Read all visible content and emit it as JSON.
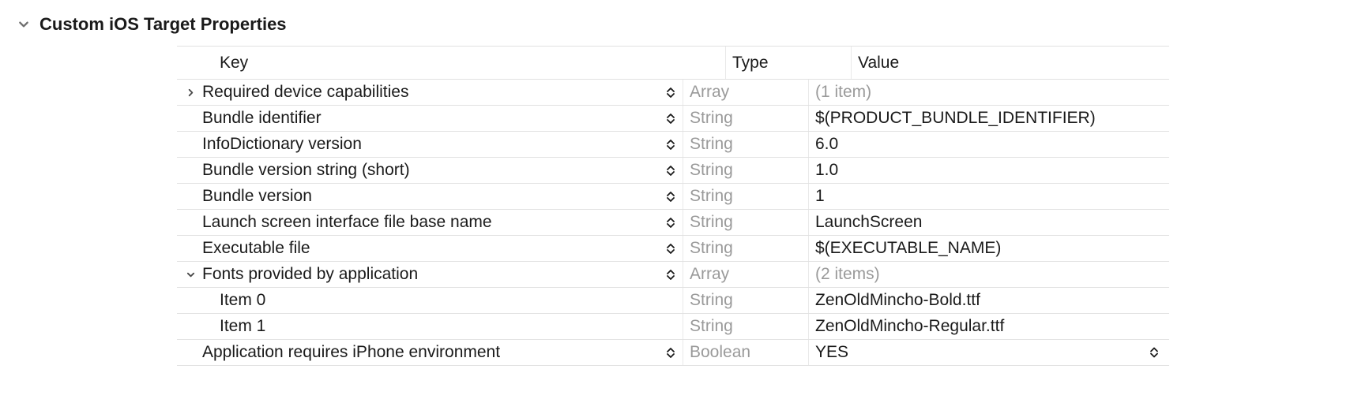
{
  "section_title": "Custom iOS Target Properties",
  "columns": {
    "key": "Key",
    "type": "Type",
    "value": "Value"
  },
  "rows": [
    {
      "key": "Required device capabilities",
      "type": "Array",
      "value": "(1 item)",
      "disclosure": "right",
      "indent": 0,
      "key_stepper": true,
      "value_gray": true,
      "value_stepper": false
    },
    {
      "key": "Bundle identifier",
      "type": "String",
      "value": "$(PRODUCT_BUNDLE_IDENTIFIER)",
      "disclosure": "none",
      "indent": 0,
      "key_stepper": true,
      "value_gray": false,
      "value_stepper": false
    },
    {
      "key": "InfoDictionary version",
      "type": "String",
      "value": "6.0",
      "disclosure": "none",
      "indent": 0,
      "key_stepper": true,
      "value_gray": false,
      "value_stepper": false
    },
    {
      "key": "Bundle version string (short)",
      "type": "String",
      "value": "1.0",
      "disclosure": "none",
      "indent": 0,
      "key_stepper": true,
      "value_gray": false,
      "value_stepper": false
    },
    {
      "key": "Bundle version",
      "type": "String",
      "value": "1",
      "disclosure": "none",
      "indent": 0,
      "key_stepper": true,
      "value_gray": false,
      "value_stepper": false
    },
    {
      "key": "Launch screen interface file base name",
      "type": "String",
      "value": "LaunchScreen",
      "disclosure": "none",
      "indent": 0,
      "key_stepper": true,
      "value_gray": false,
      "value_stepper": false
    },
    {
      "key": "Executable file",
      "type": "String",
      "value": "$(EXECUTABLE_NAME)",
      "disclosure": "none",
      "indent": 0,
      "key_stepper": true,
      "value_gray": false,
      "value_stepper": false
    },
    {
      "key": "Fonts provided by application",
      "type": "Array",
      "value": "(2 items)",
      "disclosure": "down",
      "indent": 0,
      "key_stepper": true,
      "value_gray": true,
      "value_stepper": false
    },
    {
      "key": "Item 0",
      "type": "String",
      "value": "ZenOldMincho-Bold.ttf",
      "disclosure": "none",
      "indent": 1,
      "key_stepper": false,
      "value_gray": false,
      "value_stepper": false
    },
    {
      "key": "Item 1",
      "type": "String",
      "value": "ZenOldMincho-Regular.ttf",
      "disclosure": "none",
      "indent": 1,
      "key_stepper": false,
      "value_gray": false,
      "value_stepper": false
    },
    {
      "key": "Application requires iPhone environment",
      "type": "Boolean",
      "value": "YES",
      "disclosure": "none",
      "indent": 0,
      "key_stepper": true,
      "value_gray": false,
      "value_stepper": true
    }
  ]
}
